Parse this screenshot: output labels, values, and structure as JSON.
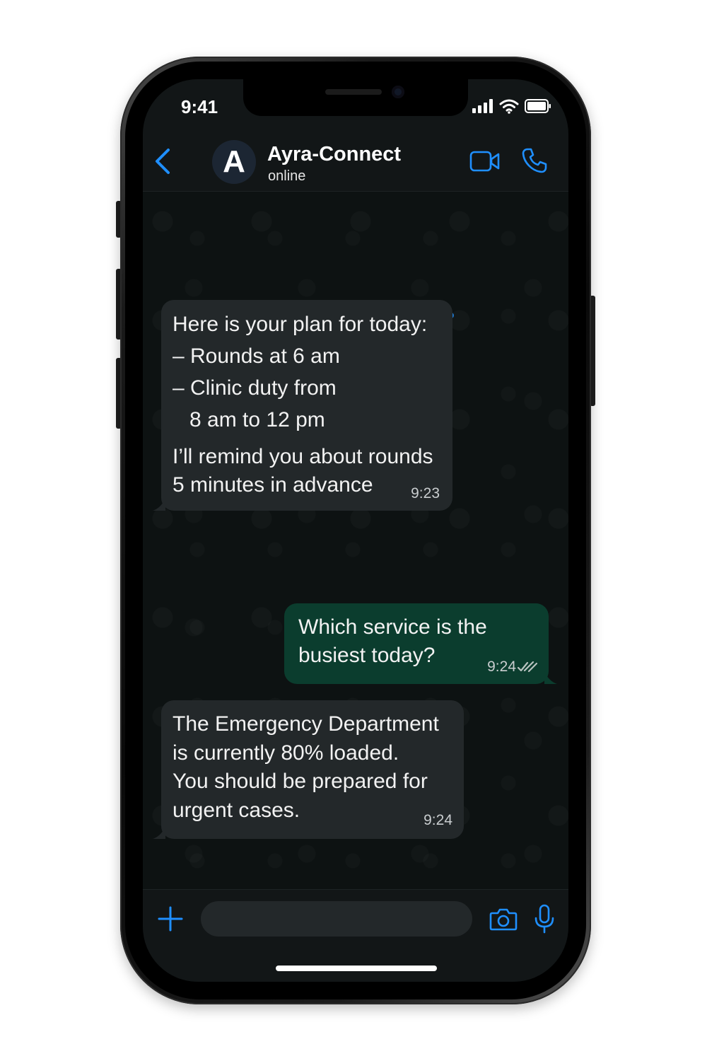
{
  "status_bar": {
    "time": "9:41",
    "icons": [
      "cellular-signal-icon",
      "wifi-icon",
      "battery-icon"
    ]
  },
  "header": {
    "avatar_letter": "A",
    "contact_name": "Ayra-Connect",
    "contact_status": "online",
    "icons": [
      "back-chevron-icon",
      "video-call-icon",
      "phone-call-icon"
    ]
  },
  "messages": [
    {
      "direction": "incoming",
      "lines": [
        "Here is your plan for today:",
        "– Rounds at 6 am",
        "– Clinic duty from",
        "8 am to 12 pm"
      ],
      "lines2": [
        "I’ll remind you about rounds",
        "5 minutes in advance"
      ],
      "time": "9:23"
    },
    {
      "direction": "outgoing",
      "lines": [
        "Which service is the",
        "busiest today?"
      ],
      "time": "9:24",
      "receipt_icon": "double-check-icon"
    },
    {
      "direction": "incoming",
      "lines": [
        "The Emergency Department",
        "is currently 80% loaded.",
        "You should be prepared for",
        "urgent cases."
      ],
      "time": "9:24"
    }
  ],
  "input_bar": {
    "message_value": "",
    "icons": [
      "plus-icon",
      "camera-icon",
      "microphone-icon"
    ]
  },
  "colors": {
    "accent": "#1f8fff",
    "incoming_bubble": "#23282a",
    "outgoing_bubble": "#0b3d2e",
    "background": "#0d1212"
  }
}
